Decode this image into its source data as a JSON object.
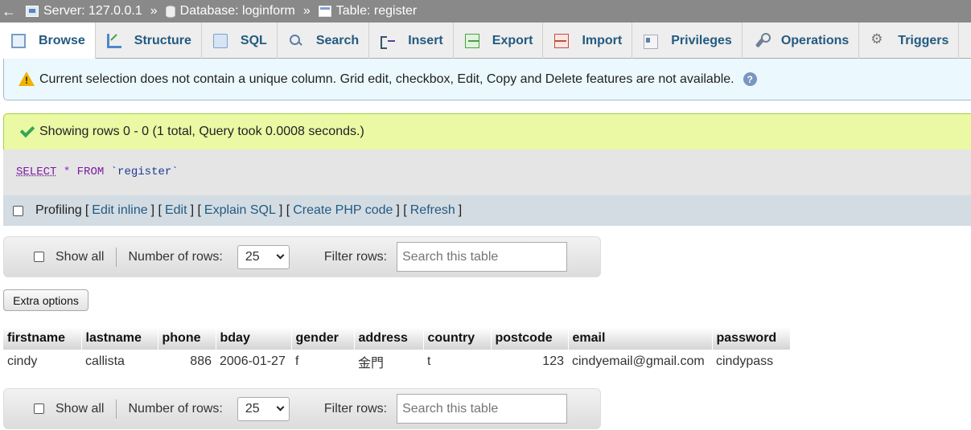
{
  "breadcrumb": {
    "back_glyph": "←",
    "server": "Server: 127.0.0.1",
    "database": "Database: loginform",
    "table": "Table: register",
    "separator": "»"
  },
  "tabs": [
    {
      "label": "Browse",
      "icon": "browse-icon",
      "active": true
    },
    {
      "label": "Structure",
      "icon": "structure-icon"
    },
    {
      "label": "SQL",
      "icon": "sql-icon"
    },
    {
      "label": "Search",
      "icon": "search-icon"
    },
    {
      "label": "Insert",
      "icon": "insert-icon"
    },
    {
      "label": "Export",
      "icon": "export-icon"
    },
    {
      "label": "Import",
      "icon": "import-icon"
    },
    {
      "label": "Privileges",
      "icon": "privileges-icon"
    },
    {
      "label": "Operations",
      "icon": "operations-icon"
    },
    {
      "label": "Triggers",
      "icon": "triggers-icon"
    }
  ],
  "notice": {
    "text": "Current selection does not contain a unique column. Grid edit, checkbox, Edit, Copy and Delete features are not available."
  },
  "success": {
    "text": "Showing rows 0 - 0 (1 total, Query took 0.0008 seconds.)"
  },
  "query": {
    "select": "SELECT",
    "star": "*",
    "from": "FROM",
    "table": "`register`"
  },
  "profiling": {
    "label": "Profiling",
    "links": [
      "Edit inline",
      "Edit",
      "Explain SQL",
      "Create PHP code",
      "Refresh"
    ]
  },
  "nav": {
    "show_all": "Show all",
    "rows_label": "Number of rows:",
    "rows_value": "25",
    "filter_label": "Filter rows:",
    "filter_placeholder": "Search this table"
  },
  "extra_options": "Extra options",
  "table": {
    "columns": [
      "firstname",
      "lastname",
      "phone",
      "bday",
      "gender",
      "address",
      "country",
      "postcode",
      "email",
      "password"
    ],
    "rows": [
      [
        "cindy",
        "callista",
        "886",
        "2006-01-27",
        "f",
        "金門",
        "t",
        "123",
        "cindyemail@gmail.com",
        "cindypass"
      ]
    ]
  },
  "colors": {
    "breadcrumb_bg": "#898989",
    "tab_text": "#235a81",
    "notice_bg": "#ebf8fd",
    "success_bg": "#ebf8a4",
    "link": "#235a81"
  }
}
